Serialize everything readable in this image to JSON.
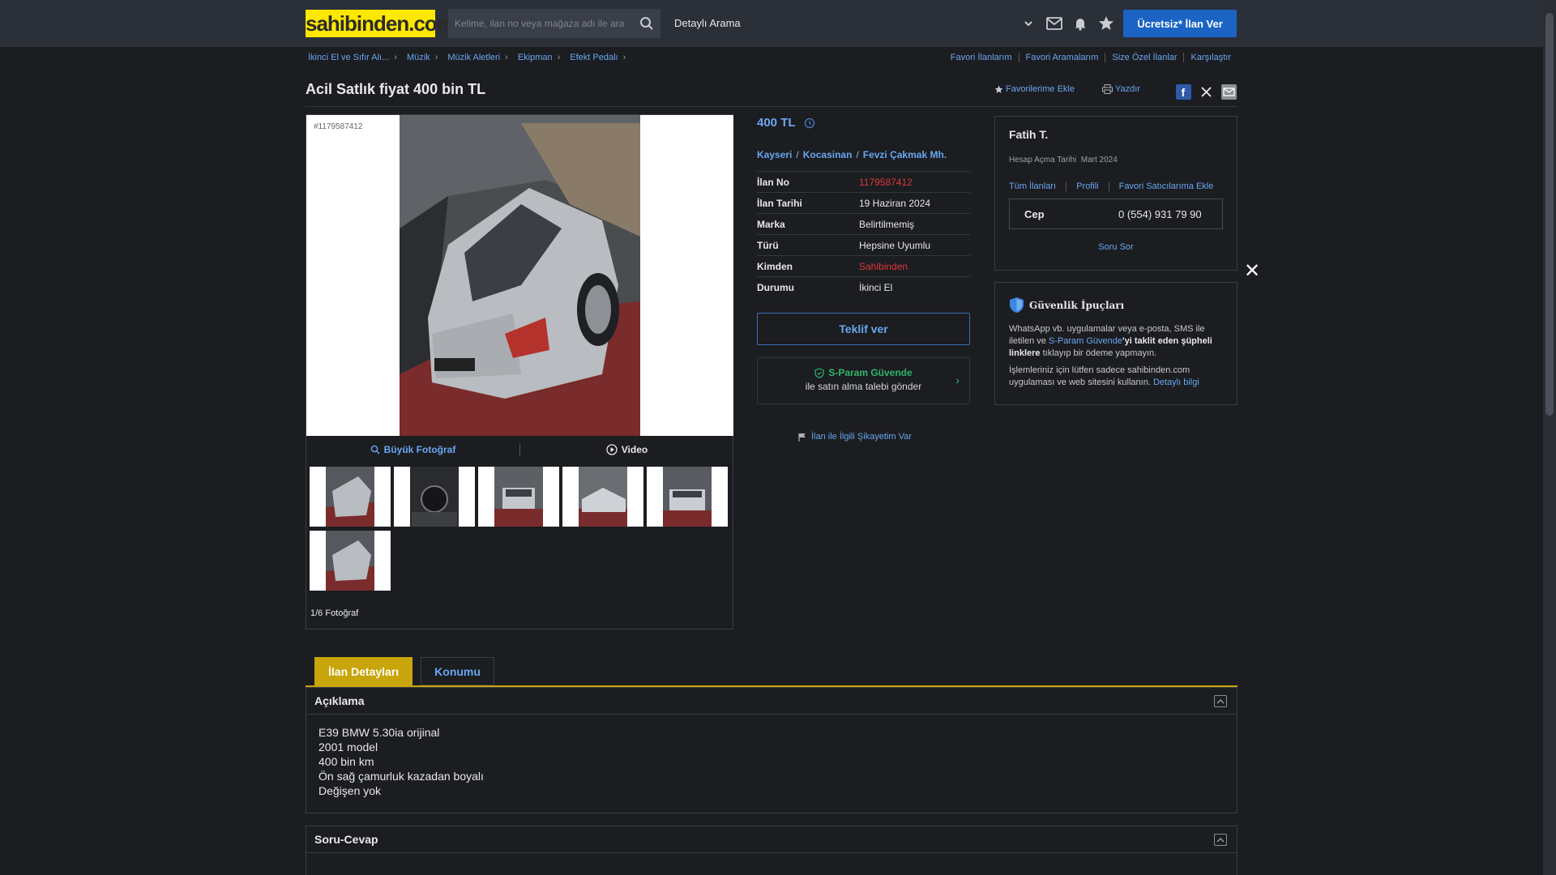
{
  "header": {
    "logo": "sahibinden.com",
    "search_placeholder": "Kelime, ilan no veya mağaza adı ile ara",
    "detailed_search": "Detaylı Arama",
    "post_button": "Ücretsiz* İlan Ver"
  },
  "breadcrumb": [
    "İkinci El ve Sıfır Alı...",
    "Müzik",
    "Müzik Aletleri",
    "Ekipman",
    "Efekt Pedalı"
  ],
  "top_links": [
    "Favori İlanlarım",
    "Favori Aramalarım",
    "Size Özel İlanlar",
    "Karşılaştır"
  ],
  "listing": {
    "title": "Acil Satlık fiyat 400 bin TL",
    "add_favorite": "Favorilerime Ekle",
    "print": "Yazdır",
    "ad_id_overlay": "#1179587412",
    "big_photo": "Büyük Fotoğraf",
    "video": "Video",
    "photo_count": "1/6 Fotoğraf",
    "price": "400 TL",
    "location": [
      "Kayseri",
      "Kocasinan",
      "Fevzi Çakmak Mh."
    ],
    "details": [
      {
        "key": "İlan No",
        "value": "1179587412"
      },
      {
        "key": "İlan Tarihi",
        "value": "19 Haziran 2024"
      },
      {
        "key": "Marka",
        "value": "Belirtilmemiş"
      },
      {
        "key": "Türü",
        "value": "Hepsine Uyumlu"
      },
      {
        "key": "Kimden",
        "value": "Sahibinden"
      },
      {
        "key": "Durumu",
        "value": "İkinci El"
      }
    ],
    "offer_button": "Teklif ver",
    "sparam_title": "S-Param Güvende",
    "sparam_sub": "ile satın alma talebi gönder",
    "complain": "İlan ile İlgili Şikayetim Var"
  },
  "seller": {
    "name": "Fatih T.",
    "since_label": "Hesap Açma Tarihi",
    "since_value": "Mart 2024",
    "links": [
      "Tüm İlanları",
      "Profili",
      "Favori Satıcılarıma Ekle"
    ],
    "phone_label": "Cep",
    "phone": "0 (554) 931 79 90",
    "ask": "Soru Sor"
  },
  "safety": {
    "title": "Güvenlik İpuçları",
    "p1_a": "WhatsApp vb. uygulamalar veya e-posta, SMS ile iletilen ve ",
    "p1_link": "S-Param Güvende",
    "p1_b": "'yi taklit eden şüpheli linklere",
    "p1_c": " tıklayıp bir ödeme yapmayın.",
    "p2_a": "İşlemleriniz için lütfen sadece sahibinden.com uygulaması ve web sitesini kullanın. ",
    "p2_link": "Detaylı bilgi"
  },
  "tabs": [
    "İlan Detayları",
    "Konumu"
  ],
  "description": {
    "title": "Açıklama",
    "lines": [
      "E39 BMW 5.30ia orijinal",
      "2001 model",
      "400 bin km",
      "Ön sağ çamurluk kazadan boyalı",
      "Değişen yok"
    ]
  },
  "qa": {
    "title": "Soru-Cevap"
  },
  "colors": {
    "accent": "#6aa6ef",
    "brand_yellow": "#ffe800",
    "primary_button": "#1b64c4",
    "tab_active": "#c8a50a",
    "danger": "#e0363b",
    "safe_green": "#2fb66b"
  }
}
